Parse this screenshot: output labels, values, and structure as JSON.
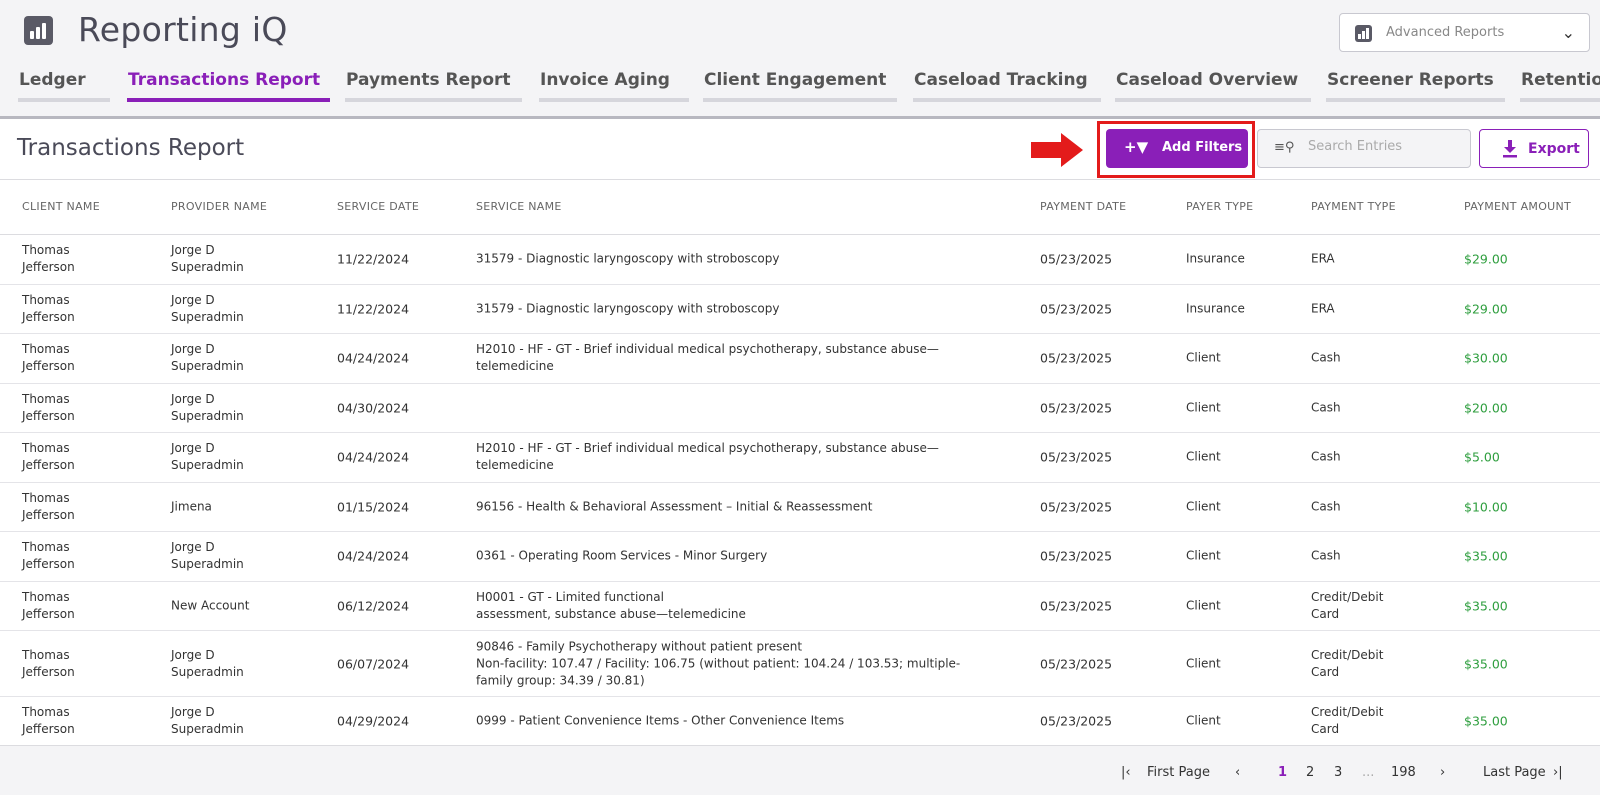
{
  "app": {
    "title": "Reporting iQ",
    "logo_icon": "bar-chart-icon"
  },
  "report_selector": {
    "value": "Advanced Reports",
    "icon": "bar-chart-icon",
    "chevron": "chevron-down-icon"
  },
  "tabs": [
    {
      "label": "Ledger",
      "active": false
    },
    {
      "label": "Transactions Report",
      "active": true
    },
    {
      "label": "Payments Report",
      "active": false
    },
    {
      "label": "Invoice Aging",
      "active": false
    },
    {
      "label": "Client Engagement",
      "active": false
    },
    {
      "label": "Caseload Tracking",
      "active": false
    },
    {
      "label": "Caseload Overview",
      "active": false
    },
    {
      "label": "Screener Reports",
      "active": false
    },
    {
      "label": "Retention",
      "active": false
    }
  ],
  "section": {
    "title": "Transactions Report"
  },
  "toolbar": {
    "add_filters_label": "Add Filters",
    "add_filters_icon": "add-filter-icon",
    "search_placeholder": "Search Entries",
    "search_value": "",
    "search_icon": "search-list-icon",
    "export_label": "Export",
    "export_icon": "download-icon"
  },
  "colors": {
    "accent": "#8a1fb8",
    "highlight": "#e31b1b",
    "amount": "#2e9e3e"
  },
  "table": {
    "headers": {
      "client": "CLIENT NAME",
      "provider": "PROVIDER NAME",
      "service_date": "SERVICE DATE",
      "service_name": "SERVICE NAME",
      "payment_date": "PAYMENT DATE",
      "payer_type": "PAYER TYPE",
      "payment_type": "PAYMENT TYPE",
      "amount": "PAYMENT AMOUNT"
    },
    "rows": [
      {
        "client": "Thomas\nJefferson",
        "provider": "Jorge D\nSuperadmin",
        "service_date": "11/22/2024",
        "service_name": "31579 - Diagnostic laryngoscopy with stroboscopy",
        "payment_date": "05/23/2025",
        "payer_type": "Insurance",
        "payment_type": "ERA",
        "amount": "$29.00"
      },
      {
        "client": "Thomas\nJefferson",
        "provider": "Jorge D\nSuperadmin",
        "service_date": "11/22/2024",
        "service_name": "31579 - Diagnostic laryngoscopy with stroboscopy",
        "payment_date": "05/23/2025",
        "payer_type": "Insurance",
        "payment_type": "ERA",
        "amount": "$29.00"
      },
      {
        "client": "Thomas\nJefferson",
        "provider": "Jorge D\nSuperadmin",
        "service_date": "04/24/2024",
        "service_name": "H2010 - HF - GT - Brief individual medical psychotherapy, substance abuse—\ntelemedicine",
        "payment_date": "05/23/2025",
        "payer_type": "Client",
        "payment_type": "Cash",
        "amount": "$30.00"
      },
      {
        "client": "Thomas\nJefferson",
        "provider": "Jorge D\nSuperadmin",
        "service_date": "04/30/2024",
        "service_name": "",
        "payment_date": "05/23/2025",
        "payer_type": "Client",
        "payment_type": "Cash",
        "amount": "$20.00"
      },
      {
        "client": "Thomas\nJefferson",
        "provider": "Jorge D\nSuperadmin",
        "service_date": "04/24/2024",
        "service_name": "H2010 - HF - GT - Brief individual medical psychotherapy, substance abuse—\ntelemedicine",
        "payment_date": "05/23/2025",
        "payer_type": "Client",
        "payment_type": "Cash",
        "amount": "$5.00"
      },
      {
        "client": "Thomas\nJefferson",
        "provider": "Jimena",
        "service_date": "01/15/2024",
        "service_name": "96156 - Health & Behavioral Assessment – Initial & Reassessment",
        "payment_date": "05/23/2025",
        "payer_type": "Client",
        "payment_type": "Cash",
        "amount": "$10.00"
      },
      {
        "client": "Thomas\nJefferson",
        "provider": "Jorge D\nSuperadmin",
        "service_date": "04/24/2024",
        "service_name": "0361 - Operating Room Services - Minor Surgery",
        "payment_date": "05/23/2025",
        "payer_type": "Client",
        "payment_type": "Cash",
        "amount": "$35.00"
      },
      {
        "client": "Thomas\nJefferson",
        "provider": "New Account",
        "service_date": "06/12/2024",
        "service_name": "H0001 - GT - Limited functional\nassessment, substance abuse—telemedicine",
        "payment_date": "05/23/2025",
        "payer_type": "Client",
        "payment_type": "Credit/Debit\nCard",
        "amount": "$35.00"
      },
      {
        "client": "Thomas\nJefferson",
        "provider": "Jorge D\nSuperadmin",
        "service_date": "06/07/2024",
        "service_name": "90846 - Family Psychotherapy without patient present\nNon-facility: 107.47 / Facility: 106.75 (without patient: 104.24 / 103.53; multiple-\nfamily group: 34.39 / 30.81)",
        "payment_date": "05/23/2025",
        "payer_type": "Client",
        "payment_type": "Credit/Debit\nCard",
        "amount": "$35.00"
      },
      {
        "client": "Thomas\nJefferson",
        "provider": "Jorge D\nSuperadmin",
        "service_date": "04/29/2024",
        "service_name": "0999 - Patient Convenience Items - Other Convenience Items",
        "payment_date": "05/23/2025",
        "payer_type": "Client",
        "payment_type": "Credit/Debit\nCard",
        "amount": "$35.00"
      }
    ]
  },
  "pagination": {
    "first_icon": "first-page-icon",
    "first_label": "First Page",
    "prev_icon": "chevron-left-icon",
    "pages": [
      "1",
      "2",
      "3"
    ],
    "current_page": "1",
    "ellipsis": "...",
    "last_page_number": "198",
    "next_icon": "chevron-right-icon",
    "last_label": "Last Page",
    "last_icon": "last-page-icon"
  }
}
